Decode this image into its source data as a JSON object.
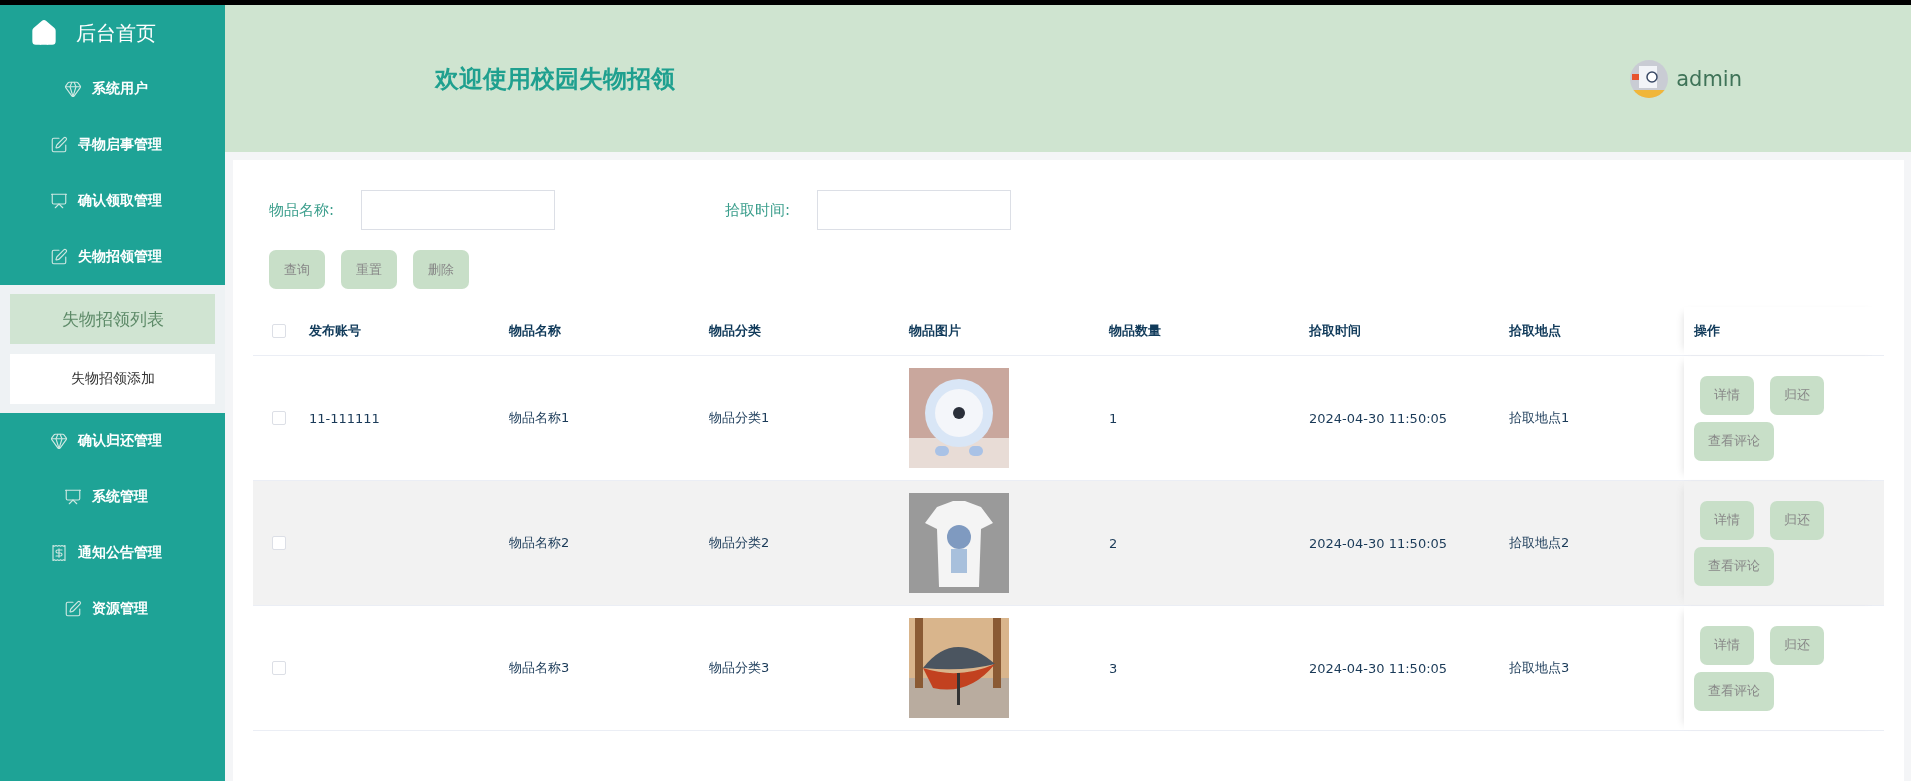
{
  "sidebar": {
    "home": "后台首页",
    "items": [
      {
        "label": "系统用户",
        "kind": "gem"
      },
      {
        "label": "寻物启事管理",
        "kind": "edit"
      },
      {
        "label": "确认领取管理",
        "kind": "chart"
      },
      {
        "label": "失物招领管理",
        "kind": "edit",
        "children": [
          {
            "label": "失物招领列表",
            "selected": true
          },
          {
            "label": "失物招领添加",
            "selected": false
          }
        ]
      },
      {
        "label": "确认归还管理",
        "kind": "gem"
      },
      {
        "label": "系统管理",
        "kind": "chart"
      },
      {
        "label": "通知公告管理",
        "kind": "receipt"
      },
      {
        "label": "资源管理",
        "kind": "edit"
      }
    ]
  },
  "header": {
    "title": "欢迎使用校园失物招领",
    "user": "admin"
  },
  "search": {
    "fields": [
      {
        "label": "物品名称:"
      },
      {
        "label": "拾取时间:"
      }
    ],
    "buttons": [
      "查询",
      "重置",
      "删除"
    ]
  },
  "table": {
    "all_checked": false,
    "columns": [
      "发布账号",
      "物品名称",
      "物品分类",
      "物品图片",
      "物品数量",
      "拾取时间",
      "拾取地点",
      "操作"
    ],
    "rows": [
      {
        "checked": false,
        "account": "11-111111",
        "name": "物品名称1",
        "category": "物品分类1",
        "quantity": "1",
        "time": "2024-04-30 11:50:05",
        "place": "拾取地点1",
        "actions": [
          "详情",
          "归还",
          "查看评论"
        ]
      },
      {
        "checked": false,
        "name": "物品名称2",
        "category": "物品分类2",
        "quantity": "2",
        "time": "2024-04-30 11:50:05",
        "place": "拾取地点2",
        "actions": [
          "详情",
          "归还",
          "查看评论"
        ]
      },
      {
        "checked": false,
        "name": "物品名称3",
        "category": "物品分类3",
        "quantity": "3",
        "time": "2024-04-30 11:50:05",
        "place": "拾取地点3",
        "actions": [
          "详情",
          "归还",
          "查看评论"
        ]
      }
    ]
  }
}
